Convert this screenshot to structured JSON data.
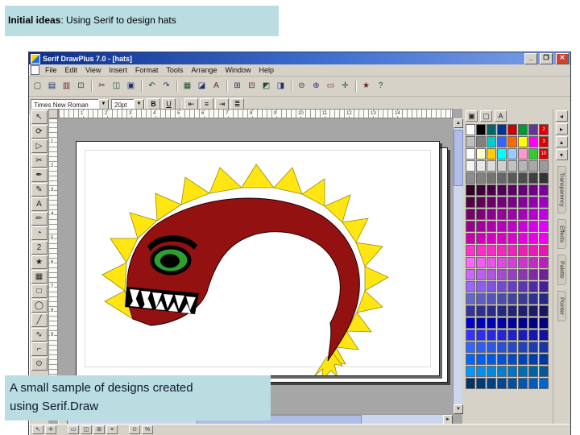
{
  "slide": {
    "top_banner_bold": "Initial ideas",
    "top_banner_rest": ": Using Serif to design hats",
    "caption_line1": "A small sample of designs created",
    "caption_line2": "using Serif.Draw"
  },
  "window": {
    "title": "Serif DrawPlus 7.0 - [hats]",
    "controls": {
      "minimize": "_",
      "restore": "❐",
      "close": "✕"
    }
  },
  "menu": {
    "items": [
      "File",
      "Edit",
      "View",
      "Insert",
      "Format",
      "Tools",
      "Arrange",
      "Window",
      "Help"
    ]
  },
  "toolbar_main": {
    "icons": [
      {
        "name": "new-icon",
        "glyph": "▢"
      },
      {
        "name": "open-icon",
        "glyph": "▤"
      },
      {
        "name": "save-icon",
        "glyph": "▥"
      },
      {
        "name": "print-icon",
        "glyph": "⊡"
      },
      "sep",
      {
        "name": "cut-icon",
        "glyph": "✂"
      },
      {
        "name": "copy-icon",
        "glyph": "◫"
      },
      {
        "name": "paste-icon",
        "glyph": "▣"
      },
      "sep",
      {
        "name": "undo-icon",
        "glyph": "↶"
      },
      {
        "name": "redo-icon",
        "glyph": "↷"
      },
      "sep",
      {
        "name": "insert-picture-icon",
        "glyph": "▦"
      },
      {
        "name": "insert-shape-icon",
        "glyph": "◪"
      },
      {
        "name": "insert-text-icon",
        "glyph": "A"
      },
      "sep",
      {
        "name": "group-icon",
        "glyph": "⊞"
      },
      {
        "name": "ungroup-icon",
        "glyph": "⊟"
      },
      {
        "name": "bring-front-icon",
        "glyph": "◩"
      },
      {
        "name": "send-back-icon",
        "glyph": "◨"
      },
      "sep",
      {
        "name": "zoom-out-icon",
        "glyph": "⊖"
      },
      {
        "name": "zoom-in-icon",
        "glyph": "⊕"
      },
      {
        "name": "fit-page-icon",
        "glyph": "▭"
      },
      {
        "name": "pan-icon",
        "glyph": "✛"
      },
      "sep",
      {
        "name": "wizard-icon",
        "glyph": "★"
      },
      {
        "name": "help-icon",
        "glyph": "?"
      }
    ]
  },
  "toolbar_format": {
    "font_name": "Times New Roman",
    "font_size": "20pt",
    "bold_label": "B",
    "underline_label": "U",
    "combo_arrow": "▼",
    "align_icons": [
      {
        "name": "flush-left-icon",
        "glyph": "⇤"
      },
      {
        "name": "center-icon",
        "glyph": "≡"
      },
      {
        "name": "flush-right-icon",
        "glyph": "⇥"
      },
      {
        "name": "justify-icon",
        "glyph": "≣"
      }
    ]
  },
  "tools": {
    "items": [
      {
        "name": "pointer-tool",
        "glyph": "↖"
      },
      {
        "name": "rotate-tool",
        "glyph": "⟳"
      },
      {
        "name": "node-edit-tool",
        "glyph": "▷"
      },
      {
        "name": "knife-tool",
        "glyph": "✂"
      },
      {
        "name": "pen-tool",
        "glyph": "✒"
      },
      {
        "name": "pencil-tool",
        "glyph": "✎"
      },
      {
        "name": "text-tool",
        "glyph": "A"
      },
      {
        "name": "brush-tool",
        "glyph": "✏"
      },
      {
        "name": "fill-tool",
        "glyph": "◔"
      },
      {
        "name": "quickshape-tool",
        "glyph": "2"
      },
      {
        "name": "star-tool",
        "glyph": "★"
      },
      {
        "name": "grid-tool",
        "glyph": "▦"
      },
      {
        "name": "rect-tool",
        "glyph": "□"
      },
      {
        "name": "ellipse-tool",
        "glyph": "◯"
      },
      {
        "name": "line-tool",
        "glyph": "╱"
      },
      {
        "name": "curve-tool",
        "glyph": "∿"
      },
      {
        "name": "connector-tool",
        "glyph": "⌐"
      },
      {
        "name": "zoom-tool",
        "glyph": "⊙"
      }
    ]
  },
  "rulers": {
    "horizontal": [
      "1",
      "2",
      "3",
      "4",
      "5",
      "6",
      "7",
      "8",
      "9",
      "10",
      "11",
      "12",
      "13",
      "14"
    ],
    "vertical": [
      "1",
      "2",
      "3",
      "4",
      "5",
      "6",
      "7",
      "8",
      "9"
    ]
  },
  "scrollbars": {
    "up": "▲",
    "down": "▼",
    "left": "◄",
    "right": "►"
  },
  "palette": {
    "header_icons": [
      {
        "name": "fill-mode-icon",
        "glyph": "▣"
      },
      {
        "name": "line-mode-icon",
        "glyph": "▢"
      },
      {
        "name": "text-color-icon",
        "glyph": "A"
      }
    ],
    "tag_color": "#dd0000",
    "tags": [
      {
        "row": 0,
        "col": 7,
        "label": "2"
      },
      {
        "row": 1,
        "col": 7,
        "label": "3"
      },
      {
        "row": 2,
        "col": 7,
        "label": "10"
      }
    ],
    "rows": [
      [
        "#ffffff",
        "#000000",
        "#006666",
        "#003399",
        "#cc0000",
        "#009933",
        "#663399",
        "#ff0000"
      ],
      [
        "#c0c0c0",
        "#808080",
        "#00cccc",
        "#3366ff",
        "#ff6600",
        "#ffff00",
        "#ff00ff",
        "#ff0000"
      ],
      [
        "#ffffff",
        "#ffffcc",
        "#ffcc00",
        "#00ffff",
        "#99ccff",
        "#ff99cc",
        "#33cc33",
        "#ff0000"
      ],
      [
        "#f5f5f5",
        "#e8e8e8",
        "#dbdbdb",
        "#cfcfcf",
        "#c2c2c2",
        "#b5b5b5",
        "#a8a8a8",
        "#9b9b9b"
      ],
      [
        "#8e8e8e",
        "#818181",
        "#747474",
        "#676767",
        "#5a5a5a",
        "#4d4d4d",
        "#404040",
        "#333333"
      ],
      [
        "#330022",
        "#3d0033",
        "#470044",
        "#520055",
        "#5c0066",
        "#660077",
        "#700088",
        "#7a0099"
      ],
      [
        "#550044",
        "#5f0055",
        "#690066",
        "#730077",
        "#7d0088",
        "#870099",
        "#9100aa",
        "#9b00bb"
      ],
      [
        "#770066",
        "#810077",
        "#8b0088",
        "#950099",
        "#9f00aa",
        "#a900bb",
        "#b300cc",
        "#bd00dd"
      ],
      [
        "#990088",
        "#a30099",
        "#ad00aa",
        "#b700bb",
        "#c100cc",
        "#cb00dd",
        "#d500ee",
        "#df00ff"
      ],
      [
        "#cc00aa",
        "#d100b4",
        "#d600be",
        "#db00c8",
        "#e000d2",
        "#e500dc",
        "#ea00e6",
        "#ef00f0"
      ],
      [
        "#ff33cc",
        "#fb2fc8",
        "#f72bc4",
        "#f327c0",
        "#ef23bc",
        "#eb1fb8",
        "#e71bb4",
        "#e317b0"
      ],
      [
        "#ff66ff",
        "#f55cf5",
        "#eb52eb",
        "#e148e1",
        "#d73ed7",
        "#cd34cd",
        "#c32ac3",
        "#b920b9"
      ],
      [
        "#cc66ff",
        "#bf5cf0",
        "#b252e1",
        "#a548d2",
        "#983ec3",
        "#8b34b4",
        "#7e2aa5",
        "#712096"
      ],
      [
        "#9966ff",
        "#8d5cf0",
        "#8152e1",
        "#7548d2",
        "#693ec3",
        "#5d34b4",
        "#512aa5",
        "#452096"
      ],
      [
        "#6666cc",
        "#5d5dc2",
        "#5454b8",
        "#4b4bae",
        "#4242a4",
        "#39399a",
        "#303090",
        "#272786"
      ],
      [
        "#333399",
        "#2f2f91",
        "#2b2b89",
        "#272781",
        "#232379",
        "#1f1f71",
        "#1b1b69",
        "#171761"
      ],
      [
        "#0000cc",
        "#0000c0",
        "#0000b4",
        "#0000a8",
        "#00009c",
        "#000090",
        "#000084",
        "#000078"
      ],
      [
        "#3333ff",
        "#2e2ef2",
        "#2929e5",
        "#2424d8",
        "#1f1fcb",
        "#1a1abe",
        "#1515b1",
        "#1010a4"
      ],
      [
        "#3366ff",
        "#2f5ff2",
        "#2b58e5",
        "#2751d8",
        "#234acb",
        "#1f43be",
        "#1b3cb1",
        "#1735a4"
      ],
      [
        "#0066ff",
        "#005ff2",
        "#0058e5",
        "#0051d8",
        "#004acb",
        "#0043be",
        "#003cb1",
        "#0035a4"
      ],
      [
        "#0099ff",
        "#0090f0",
        "#0087e1",
        "#007ed2",
        "#0075c3",
        "#006cb4",
        "#0063a5",
        "#005a96"
      ],
      [
        "#003366",
        "#003a75",
        "#004184",
        "#004893",
        "#004fa2",
        "#0056b1",
        "#005dc0",
        "#0064cf"
      ]
    ]
  },
  "studio_tabs": {
    "icons": [
      {
        "name": "studio-pin-icon",
        "glyph": "◂"
      },
      {
        "name": "studio-flip-icon",
        "glyph": "▸"
      },
      {
        "name": "studio-up-icon",
        "glyph": "▴"
      },
      {
        "name": "studio-down-icon",
        "glyph": "▾"
      }
    ],
    "labels": [
      "Transparency",
      "Effects",
      "Palette",
      "Pointer"
    ]
  },
  "statusbar": {
    "icons": [
      {
        "name": "status-pointer-icon",
        "glyph": "↖"
      },
      {
        "name": "status-pan-icon",
        "glyph": "✛"
      },
      {
        "name": "status-frame-icon",
        "glyph": "▭"
      },
      {
        "name": "status-pages-icon",
        "glyph": "◫"
      },
      {
        "name": "status-grid-icon",
        "glyph": "⊞"
      },
      {
        "name": "status-snap-icon",
        "glyph": "≡"
      },
      {
        "name": "status-zoom-icon",
        "glyph": "⊙"
      },
      {
        "name": "status-percent-icon",
        "glyph": "%"
      }
    ]
  },
  "artwork": {
    "body_color": "#941111",
    "spike_color": "#ffe612",
    "spike_stroke": "#9a8a00",
    "eye_color": "#2f9e2f",
    "outline_color": "#000000"
  }
}
